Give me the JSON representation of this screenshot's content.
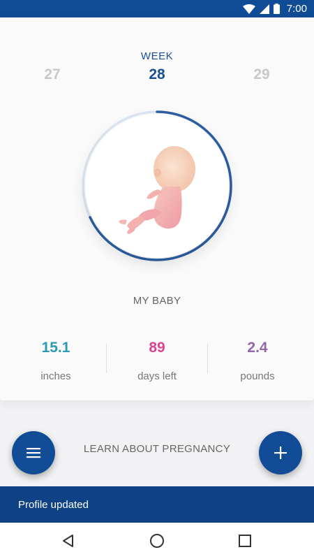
{
  "status_bar": {
    "time": "7:00",
    "icons": [
      "wifi-icon",
      "signal-icon",
      "battery-icon"
    ],
    "background": "#104b96"
  },
  "week_selector": {
    "label": "WEEK",
    "prev": "27",
    "current": "28",
    "next": "29",
    "progress": 0.68
  },
  "baby": {
    "title": "MY BABY",
    "illustration": "fetus-illustration"
  },
  "stats": [
    {
      "value": "15.1",
      "label": "inches",
      "color": "#2a9bb2"
    },
    {
      "value": "89",
      "label": "days left",
      "color": "#d6458f"
    },
    {
      "value": "2.4",
      "label": "pounds",
      "color": "#9266a8"
    }
  ],
  "learn_label": "LEARN ABOUT PREGNANCY",
  "fab_menu_icon": "menu-icon",
  "fab_add_icon": "plus-icon",
  "snackbar": {
    "message": "Profile updated"
  },
  "nav": {
    "back_icon": "back-icon",
    "home_icon": "home-icon",
    "recents_icon": "recents-icon"
  },
  "colors": {
    "primary": "#124b96",
    "ring": "#2c5fa4"
  }
}
